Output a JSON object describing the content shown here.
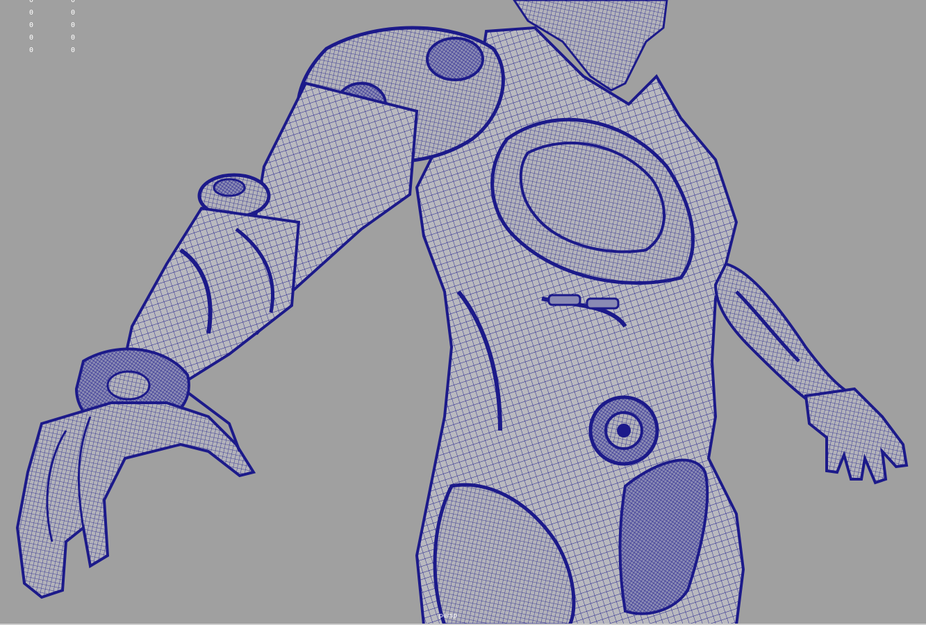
{
  "viewport": {
    "camera_label": "persp",
    "background_color": "#a0a0a0",
    "wireframe_color": "#1c1a8a",
    "shaded_color": "#b7b7b7"
  },
  "hud": {
    "column_a": [
      "0",
      "0",
      "0",
      "0",
      "0"
    ],
    "column_b": [
      "0",
      "0",
      "0",
      "0",
      "0"
    ]
  },
  "model": {
    "display_mode": "wireframe-on-shaded",
    "subject": "armored humanoid"
  }
}
